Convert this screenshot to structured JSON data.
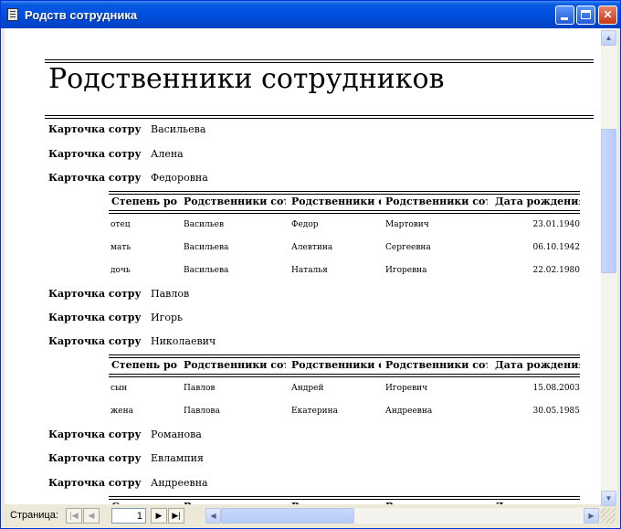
{
  "window": {
    "title": "Родств сотрудника"
  },
  "report": {
    "title": "Родственники сотрудников",
    "card_label": "Карточка сотру",
    "column_headers": [
      "Степень ро",
      "Родственники сот",
      "Родственники с",
      "Родственники сот",
      "Дата рождения"
    ],
    "employees": [
      {
        "last_name": "Васильева",
        "first_name": "Алена",
        "patronymic": "Федоровна",
        "relatives": [
          [
            "отец",
            "Васильев",
            "Федор",
            "Мартович",
            "23.01.1940"
          ],
          [
            "мать",
            "Васильева",
            "Алевтина",
            "Сергеевна",
            "06.10.1942"
          ],
          [
            "дочь",
            "Васильева",
            "Наталья",
            "Игоревна",
            "22.02.1980"
          ]
        ]
      },
      {
        "last_name": "Павлов",
        "first_name": "Игорь",
        "patronymic": "Николаевич",
        "relatives": [
          [
            "сын",
            "Павлов",
            "Андрей",
            "Игоревич",
            "15.08.2003"
          ],
          [
            "жена",
            "Павлова",
            "Екатерина",
            "Андреевна",
            "30.05.1985"
          ]
        ]
      },
      {
        "last_name": "Романова",
        "first_name": "Евлампия",
        "patronymic": "Андреевна",
        "relatives": []
      }
    ]
  },
  "navigation": {
    "label": "Страница:",
    "page": "1"
  },
  "colors": {
    "titlebar": "#0053E1",
    "frame": "#ECE9D8",
    "close_button": "#C5391A"
  }
}
